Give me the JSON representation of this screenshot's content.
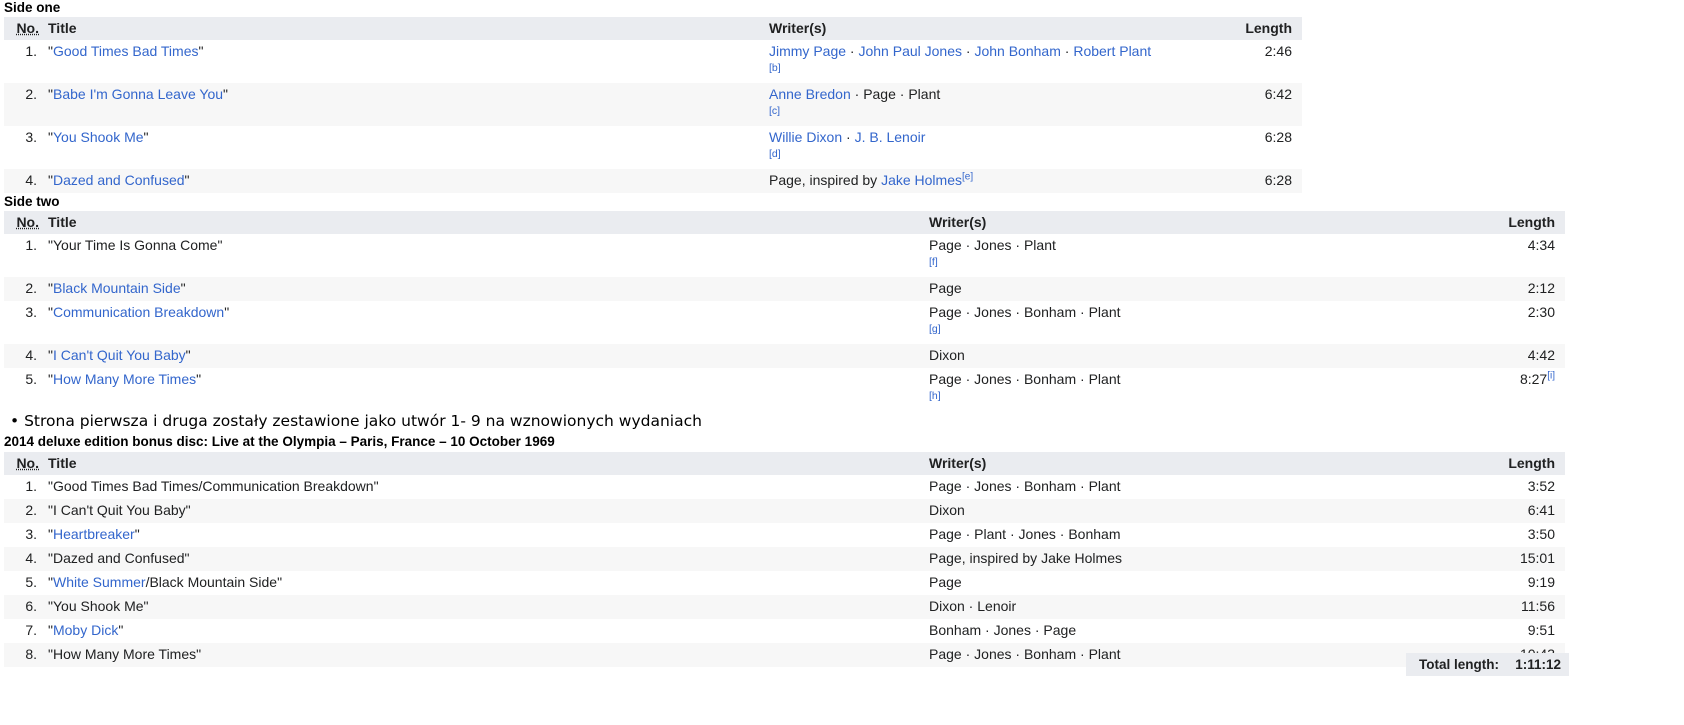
{
  "headers": {
    "no": "No.",
    "title": "Title",
    "writers": "Writer(s)",
    "length": "Length"
  },
  "side_one": {
    "caption": "Side one",
    "tracks": [
      {
        "no": "1.",
        "title": "Good Times Bad Times",
        "title_link": true,
        "writers": [
          {
            "name": "Jimmy Page",
            "link": true
          },
          {
            "name": "John Paul Jones",
            "link": true
          },
          {
            "name": "John Bonham",
            "link": true
          },
          {
            "name": "Robert Plant",
            "link": true
          }
        ],
        "note": "[b]",
        "length": "2:46"
      },
      {
        "no": "2.",
        "title": "Babe I'm Gonna Leave You",
        "title_link": true,
        "writers": [
          {
            "name": "Anne Bredon",
            "link": true
          },
          {
            "name": "Page",
            "link": false
          },
          {
            "name": "Plant",
            "link": false
          }
        ],
        "note": "[c]",
        "length": "6:42"
      },
      {
        "no": "3.",
        "title": "You Shook Me",
        "title_link": true,
        "writers": [
          {
            "name": "Willie Dixon",
            "link": true
          },
          {
            "name": "J. B. Lenoir",
            "link": true
          }
        ],
        "note": "[d]",
        "length": "6:28"
      },
      {
        "no": "4.",
        "title": "Dazed and Confused",
        "title_link": true,
        "writers_prefix": "Page, inspired by ",
        "writers": [
          {
            "name": "Jake Holmes",
            "link": true
          }
        ],
        "sup": "[e]",
        "length": "6:28"
      }
    ]
  },
  "side_two": {
    "caption": "Side two",
    "tracks": [
      {
        "no": "1.",
        "title": "Your Time Is Gonna Come",
        "title_link": false,
        "writers": [
          {
            "name": "Page",
            "link": false
          },
          {
            "name": "Jones",
            "link": false
          },
          {
            "name": "Plant",
            "link": false
          }
        ],
        "note": "[f]",
        "length": "4:34"
      },
      {
        "no": "2.",
        "title": "Black Mountain Side",
        "title_link": true,
        "writers": [
          {
            "name": "Page",
            "link": false
          }
        ],
        "length": "2:12"
      },
      {
        "no": "3.",
        "title": "Communication Breakdown",
        "title_link": true,
        "writers": [
          {
            "name": "Page",
            "link": false
          },
          {
            "name": "Jones",
            "link": false
          },
          {
            "name": "Bonham",
            "link": false
          },
          {
            "name": "Plant",
            "link": false
          }
        ],
        "note": "[g]",
        "length": "2:30"
      },
      {
        "no": "4.",
        "title": "I Can't Quit You Baby",
        "title_link": true,
        "writers": [
          {
            "name": "Dixon",
            "link": false
          }
        ],
        "length": "4:42"
      },
      {
        "no": "5.",
        "title": "How Many More Times",
        "title_link": true,
        "writers": [
          {
            "name": "Page",
            "link": false
          },
          {
            "name": "Jones",
            "link": false
          },
          {
            "name": "Bonham",
            "link": false
          },
          {
            "name": "Plant",
            "link": false
          }
        ],
        "note": "[h]",
        "length": "8:27",
        "length_sup": "[i]"
      }
    ]
  },
  "bullet_note": "• Strona pierwsza i druga zostały zestawione jako utwór 1- 9 na wznowionych wydaniach",
  "bonus": {
    "caption": "2014 deluxe edition bonus disc: Live at the Olympia – Paris, France – 10 October 1969",
    "tracks": [
      {
        "no": "1.",
        "title_parts": [
          {
            "text": "Good Times Bad Times/Communication Breakdown",
            "link": false
          }
        ],
        "writers": [
          {
            "name": "Page",
            "link": false
          },
          {
            "name": "Jones",
            "link": false
          },
          {
            "name": "Bonham",
            "link": false
          },
          {
            "name": "Plant",
            "link": false
          }
        ],
        "length": "3:52"
      },
      {
        "no": "2.",
        "title_parts": [
          {
            "text": "I Can't Quit You Baby",
            "link": false
          }
        ],
        "writers": [
          {
            "name": "Dixon",
            "link": false
          }
        ],
        "length": "6:41"
      },
      {
        "no": "3.",
        "title_parts": [
          {
            "text": "Heartbreaker",
            "link": true
          }
        ],
        "writers": [
          {
            "name": "Page",
            "link": false
          },
          {
            "name": "Plant",
            "link": false
          },
          {
            "name": "Jones",
            "link": false
          },
          {
            "name": "Bonham",
            "link": false
          }
        ],
        "length": "3:50"
      },
      {
        "no": "4.",
        "title_parts": [
          {
            "text": "Dazed and Confused",
            "link": false
          }
        ],
        "writers_prefix": "Page, inspired by Jake Holmes",
        "writers": [],
        "length": "15:01"
      },
      {
        "no": "5.",
        "title_parts": [
          {
            "text": "White Summer",
            "link": true
          },
          {
            "text": "/Black Mountain Side",
            "link": false
          }
        ],
        "writers": [
          {
            "name": "Page",
            "link": false
          }
        ],
        "length": "9:19"
      },
      {
        "no": "6.",
        "title_parts": [
          {
            "text": "You Shook Me",
            "link": false
          }
        ],
        "writers": [
          {
            "name": "Dixon",
            "link": false
          },
          {
            "name": "Lenoir",
            "link": false
          }
        ],
        "length": "11:56"
      },
      {
        "no": "7.",
        "title_parts": [
          {
            "text": "Moby Dick",
            "link": true
          }
        ],
        "writers": [
          {
            "name": "Bonham",
            "link": false
          },
          {
            "name": "Jones",
            "link": false
          },
          {
            "name": "Page",
            "link": false
          }
        ],
        "length": "9:51"
      },
      {
        "no": "8.",
        "title_parts": [
          {
            "text": "How Many More Times",
            "link": false
          }
        ],
        "writers": [
          {
            "name": "Page",
            "link": false
          },
          {
            "name": "Jones",
            "link": false
          },
          {
            "name": "Bonham",
            "link": false
          },
          {
            "name": "Plant",
            "link": false
          }
        ],
        "length": "10:43"
      }
    ],
    "total_label": "Total length:",
    "total_value": "1:11:12"
  }
}
